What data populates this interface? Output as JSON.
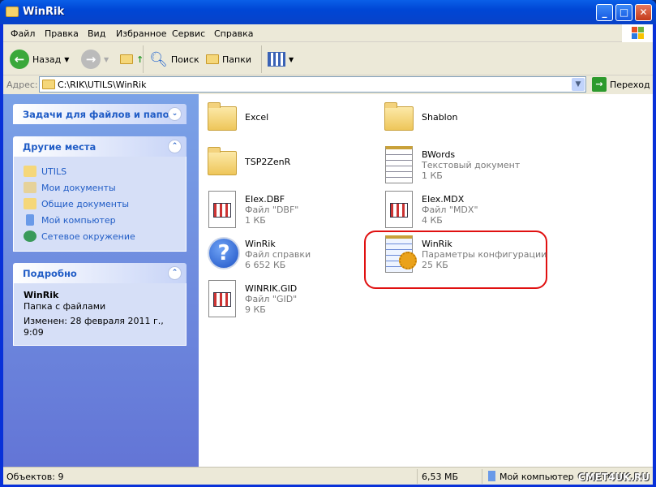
{
  "window": {
    "title": "WinRik"
  },
  "menu": [
    "Файл",
    "Правка",
    "Вид",
    "Избранное",
    "Сервис",
    "Справка"
  ],
  "toolbar": {
    "back": "Назад",
    "search": "Поиск",
    "folders": "Папки"
  },
  "address": {
    "label": "Адрес:",
    "value": "C:\\RIK\\UTILS\\WinRik",
    "go": "Переход"
  },
  "tasks": {
    "title": "Задачи для файлов и папок"
  },
  "other_places": {
    "title": "Другие места",
    "items": [
      "UTILS",
      "Мои документы",
      "Общие документы",
      "Мой компьютер",
      "Сетевое окружение"
    ]
  },
  "details": {
    "title": "Подробно",
    "name": "WinRik",
    "type": "Папка с файлами",
    "modified": "Изменен: 28 февраля 2011 г., 9:09"
  },
  "files": [
    {
      "name": "Excel",
      "type": "",
      "size": "",
      "icon": "folder"
    },
    {
      "name": "Shablon",
      "type": "",
      "size": "",
      "icon": "folder"
    },
    {
      "name": "TSP2ZenR",
      "type": "",
      "size": "",
      "icon": "folder"
    },
    {
      "name": "BWords",
      "type": "Текстовый документ",
      "size": "1 КБ",
      "icon": "text"
    },
    {
      "name": "EIex.DBF",
      "type": "Файл \"DBF\"",
      "size": "1 КБ",
      "icon": "app"
    },
    {
      "name": "EIex.MDX",
      "type": "Файл \"MDX\"",
      "size": "4 КБ",
      "icon": "app"
    },
    {
      "name": "WinRik",
      "type": "Файл справки",
      "size": "6 652 КБ",
      "icon": "help"
    },
    {
      "name": "WinRik",
      "type": "Параметры конфигурации",
      "size": "25 КБ",
      "icon": "config"
    },
    {
      "name": "WINRIK.GID",
      "type": "Файл \"GID\"",
      "size": "9 КБ",
      "icon": "app"
    }
  ],
  "status": {
    "objects": "Объектов: 9",
    "size": "6,53 МБ",
    "location": "Мой компьютер",
    "watermark": "CMET4UK.RU"
  }
}
